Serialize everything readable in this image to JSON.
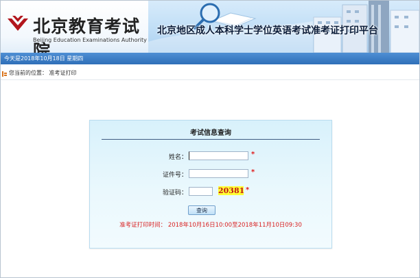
{
  "header": {
    "logo_cn": "北京教育考试院",
    "logo_en": "Beijing Education Examinations Authority",
    "title": "北京地区成人本科学士学位英语考试准考证打印平台"
  },
  "datebar": {
    "text": "今天是2018年10月18日 星期四"
  },
  "breadcrumb": {
    "text": "您当前的位置：  准考证打印"
  },
  "form": {
    "title": "考试信息查询",
    "name_label": "姓名：",
    "name_value": "",
    "id_label": "证件号：",
    "id_value": "",
    "captcha_label": "验证码：",
    "captcha_value": "",
    "captcha_code": "20381",
    "required_mark": "*",
    "submit_label": "查询",
    "notice": "准考证打印时间：  2018年10月16日10:00至2018年11月10日09:30"
  },
  "colors": {
    "header_bar": "#2f6fb8",
    "required": "#e01b1b",
    "captcha_bg": "#ffff33",
    "captcha_text": "#c01818"
  }
}
